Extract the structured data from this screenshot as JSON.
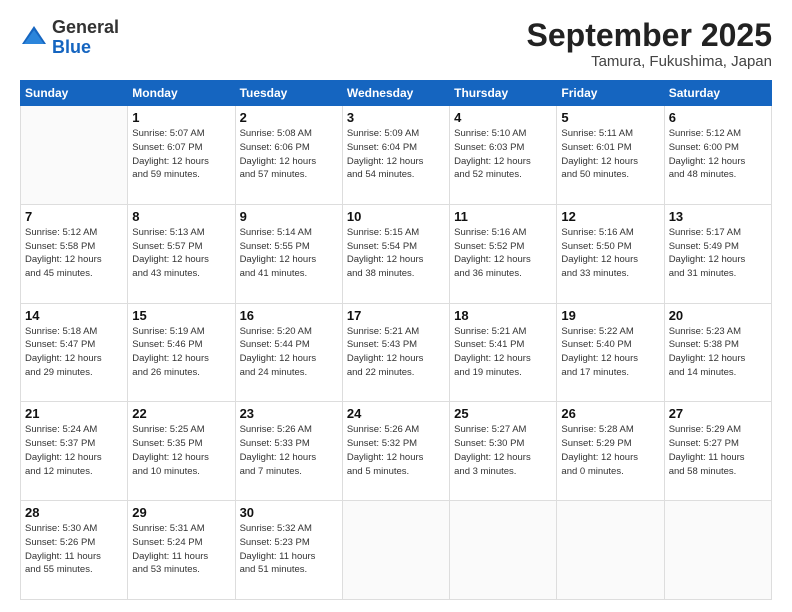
{
  "header": {
    "logo_general": "General",
    "logo_blue": "Blue",
    "month_title": "September 2025",
    "location": "Tamura, Fukushima, Japan"
  },
  "days_of_week": [
    "Sunday",
    "Monday",
    "Tuesday",
    "Wednesday",
    "Thursday",
    "Friday",
    "Saturday"
  ],
  "weeks": [
    [
      {
        "day": "",
        "info": ""
      },
      {
        "day": "1",
        "info": "Sunrise: 5:07 AM\nSunset: 6:07 PM\nDaylight: 12 hours\nand 59 minutes."
      },
      {
        "day": "2",
        "info": "Sunrise: 5:08 AM\nSunset: 6:06 PM\nDaylight: 12 hours\nand 57 minutes."
      },
      {
        "day": "3",
        "info": "Sunrise: 5:09 AM\nSunset: 6:04 PM\nDaylight: 12 hours\nand 54 minutes."
      },
      {
        "day": "4",
        "info": "Sunrise: 5:10 AM\nSunset: 6:03 PM\nDaylight: 12 hours\nand 52 minutes."
      },
      {
        "day": "5",
        "info": "Sunrise: 5:11 AM\nSunset: 6:01 PM\nDaylight: 12 hours\nand 50 minutes."
      },
      {
        "day": "6",
        "info": "Sunrise: 5:12 AM\nSunset: 6:00 PM\nDaylight: 12 hours\nand 48 minutes."
      }
    ],
    [
      {
        "day": "7",
        "info": "Sunrise: 5:12 AM\nSunset: 5:58 PM\nDaylight: 12 hours\nand 45 minutes."
      },
      {
        "day": "8",
        "info": "Sunrise: 5:13 AM\nSunset: 5:57 PM\nDaylight: 12 hours\nand 43 minutes."
      },
      {
        "day": "9",
        "info": "Sunrise: 5:14 AM\nSunset: 5:55 PM\nDaylight: 12 hours\nand 41 minutes."
      },
      {
        "day": "10",
        "info": "Sunrise: 5:15 AM\nSunset: 5:54 PM\nDaylight: 12 hours\nand 38 minutes."
      },
      {
        "day": "11",
        "info": "Sunrise: 5:16 AM\nSunset: 5:52 PM\nDaylight: 12 hours\nand 36 minutes."
      },
      {
        "day": "12",
        "info": "Sunrise: 5:16 AM\nSunset: 5:50 PM\nDaylight: 12 hours\nand 33 minutes."
      },
      {
        "day": "13",
        "info": "Sunrise: 5:17 AM\nSunset: 5:49 PM\nDaylight: 12 hours\nand 31 minutes."
      }
    ],
    [
      {
        "day": "14",
        "info": "Sunrise: 5:18 AM\nSunset: 5:47 PM\nDaylight: 12 hours\nand 29 minutes."
      },
      {
        "day": "15",
        "info": "Sunrise: 5:19 AM\nSunset: 5:46 PM\nDaylight: 12 hours\nand 26 minutes."
      },
      {
        "day": "16",
        "info": "Sunrise: 5:20 AM\nSunset: 5:44 PM\nDaylight: 12 hours\nand 24 minutes."
      },
      {
        "day": "17",
        "info": "Sunrise: 5:21 AM\nSunset: 5:43 PM\nDaylight: 12 hours\nand 22 minutes."
      },
      {
        "day": "18",
        "info": "Sunrise: 5:21 AM\nSunset: 5:41 PM\nDaylight: 12 hours\nand 19 minutes."
      },
      {
        "day": "19",
        "info": "Sunrise: 5:22 AM\nSunset: 5:40 PM\nDaylight: 12 hours\nand 17 minutes."
      },
      {
        "day": "20",
        "info": "Sunrise: 5:23 AM\nSunset: 5:38 PM\nDaylight: 12 hours\nand 14 minutes."
      }
    ],
    [
      {
        "day": "21",
        "info": "Sunrise: 5:24 AM\nSunset: 5:37 PM\nDaylight: 12 hours\nand 12 minutes."
      },
      {
        "day": "22",
        "info": "Sunrise: 5:25 AM\nSunset: 5:35 PM\nDaylight: 12 hours\nand 10 minutes."
      },
      {
        "day": "23",
        "info": "Sunrise: 5:26 AM\nSunset: 5:33 PM\nDaylight: 12 hours\nand 7 minutes."
      },
      {
        "day": "24",
        "info": "Sunrise: 5:26 AM\nSunset: 5:32 PM\nDaylight: 12 hours\nand 5 minutes."
      },
      {
        "day": "25",
        "info": "Sunrise: 5:27 AM\nSunset: 5:30 PM\nDaylight: 12 hours\nand 3 minutes."
      },
      {
        "day": "26",
        "info": "Sunrise: 5:28 AM\nSunset: 5:29 PM\nDaylight: 12 hours\nand 0 minutes."
      },
      {
        "day": "27",
        "info": "Sunrise: 5:29 AM\nSunset: 5:27 PM\nDaylight: 11 hours\nand 58 minutes."
      }
    ],
    [
      {
        "day": "28",
        "info": "Sunrise: 5:30 AM\nSunset: 5:26 PM\nDaylight: 11 hours\nand 55 minutes."
      },
      {
        "day": "29",
        "info": "Sunrise: 5:31 AM\nSunset: 5:24 PM\nDaylight: 11 hours\nand 53 minutes."
      },
      {
        "day": "30",
        "info": "Sunrise: 5:32 AM\nSunset: 5:23 PM\nDaylight: 11 hours\nand 51 minutes."
      },
      {
        "day": "",
        "info": ""
      },
      {
        "day": "",
        "info": ""
      },
      {
        "day": "",
        "info": ""
      },
      {
        "day": "",
        "info": ""
      }
    ]
  ]
}
